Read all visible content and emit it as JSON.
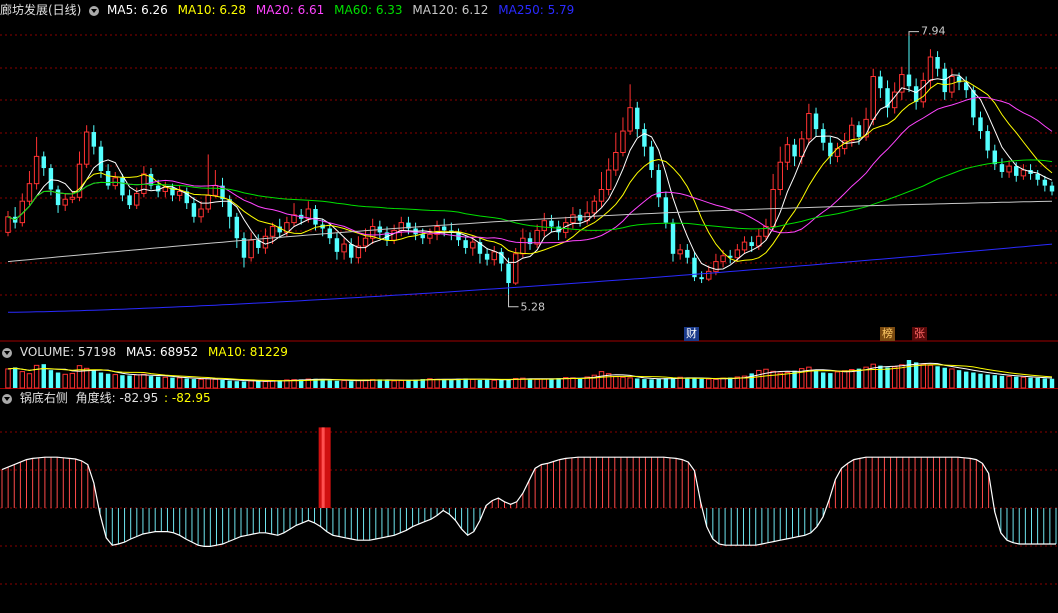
{
  "header_main": {
    "stock": "廊坊发展(日线)",
    "ma5": "MA5: 6.26",
    "ma10": "MA10: 6.28",
    "ma20": "MA20: 6.61",
    "ma60": "MA60: 6.33",
    "ma120": "MA120: 6.12",
    "ma250": "MA250: 5.79"
  },
  "header_volume": {
    "volume": "VOLUME: 57198",
    "ma5": "MA5: 68952",
    "ma10": "MA10: 81229"
  },
  "header_indicator": {
    "name": "锅底右侧",
    "angle_label": "角度线: -82.95",
    "angle_value": ": -82.95"
  },
  "annotations": {
    "high": "7.94",
    "low": "5.28",
    "marker_cai": "财",
    "marker_bang": "榜",
    "marker_zhang": "张"
  },
  "colors": {
    "ma5": "#ffffff",
    "ma10": "#ffff00",
    "ma20": "#ff44ff",
    "ma60": "#00e000",
    "ma120": "#c8c8c8",
    "ma250": "#2a2aff",
    "up": "#ff3232",
    "down": "#54ffff",
    "grid": "#8a0000"
  },
  "chart_data": [
    {
      "type": "candlestick",
      "title": "廊坊发展(日线)",
      "ylim": [
        5.0,
        8.1
      ],
      "annotations": [
        {
          "label": "7.94",
          "value": 7.94
        },
        {
          "label": "5.28",
          "value": 5.28
        }
      ],
      "candles": [
        [
          5.92,
          6.08,
          6.14,
          5.88
        ],
        [
          6.08,
          6.02,
          6.18,
          5.96
        ],
        [
          6.02,
          6.24,
          6.32,
          5.98
        ],
        [
          6.24,
          6.42,
          6.55,
          6.2
        ],
        [
          6.42,
          6.7,
          6.9,
          6.36
        ],
        [
          6.7,
          6.58,
          6.75,
          6.5
        ],
        [
          6.58,
          6.36,
          6.62,
          6.3
        ],
        [
          6.36,
          6.2,
          6.4,
          6.12
        ],
        [
          6.2,
          6.26,
          6.32,
          6.14
        ],
        [
          6.26,
          6.28,
          6.34,
          6.22
        ],
        [
          6.28,
          6.62,
          6.75,
          6.24
        ],
        [
          6.62,
          6.95,
          7.02,
          6.58
        ],
        [
          6.95,
          6.8,
          7.02,
          6.72
        ],
        [
          6.8,
          6.55,
          6.86,
          6.48
        ],
        [
          6.55,
          6.4,
          6.62,
          6.36
        ],
        [
          6.4,
          6.48,
          6.54,
          6.36
        ],
        [
          6.48,
          6.3,
          6.52,
          6.24
        ],
        [
          6.3,
          6.2,
          6.36,
          6.16
        ],
        [
          6.2,
          6.32,
          6.38,
          6.16
        ],
        [
          6.32,
          6.52,
          6.6,
          6.28
        ],
        [
          6.52,
          6.4,
          6.58,
          6.36
        ],
        [
          6.4,
          6.34,
          6.46,
          6.28
        ],
        [
          6.34,
          6.38,
          6.44,
          6.28
        ],
        [
          6.38,
          6.3,
          6.42,
          6.24
        ],
        [
          6.3,
          6.34,
          6.4,
          6.24
        ],
        [
          6.34,
          6.22,
          6.38,
          6.16
        ],
        [
          6.22,
          6.08,
          6.28,
          6.02
        ],
        [
          6.08,
          6.16,
          6.24,
          6.02
        ],
        [
          6.16,
          6.3,
          6.72,
          6.12
        ],
        [
          6.3,
          6.4,
          6.56,
          6.28
        ],
        [
          6.4,
          6.26,
          6.48,
          6.18
        ],
        [
          6.26,
          6.08,
          6.3,
          5.96
        ],
        [
          6.08,
          5.86,
          6.12,
          5.76
        ],
        [
          5.86,
          5.66,
          5.92,
          5.56
        ],
        [
          5.66,
          5.84,
          5.92,
          5.62
        ],
        [
          5.84,
          5.76,
          5.9,
          5.7
        ],
        [
          5.76,
          5.88,
          5.96,
          5.7
        ],
        [
          5.88,
          5.98,
          6.02,
          5.8
        ],
        [
          5.98,
          5.92,
          6.06,
          5.86
        ],
        [
          5.92,
          6.02,
          6.08,
          5.88
        ],
        [
          6.02,
          6.1,
          6.22,
          5.98
        ],
        [
          6.1,
          6.06,
          6.16,
          6.0
        ],
        [
          6.06,
          6.16,
          6.24,
          6.02
        ],
        [
          6.16,
          6.0,
          6.2,
          5.94
        ],
        [
          6.0,
          5.96,
          6.06,
          5.88
        ],
        [
          5.96,
          5.86,
          6.0,
          5.8
        ],
        [
          5.86,
          5.72,
          5.92,
          5.64
        ],
        [
          5.72,
          5.8,
          5.86,
          5.64
        ],
        [
          5.8,
          5.66,
          5.86,
          5.6
        ],
        [
          5.66,
          5.78,
          5.88,
          5.6
        ],
        [
          5.78,
          5.86,
          5.96,
          5.72
        ],
        [
          5.86,
          5.98,
          6.06,
          5.8
        ],
        [
          5.98,
          5.92,
          6.04,
          5.86
        ],
        [
          5.92,
          5.84,
          5.98,
          5.78
        ],
        [
          5.84,
          5.94,
          6.0,
          5.8
        ],
        [
          5.94,
          6.02,
          6.08,
          5.88
        ],
        [
          6.02,
          5.96,
          6.08,
          5.9
        ],
        [
          5.96,
          5.9,
          6.02,
          5.84
        ],
        [
          5.9,
          5.86,
          5.96,
          5.8
        ],
        [
          5.86,
          5.9,
          5.96,
          5.8
        ],
        [
          5.9,
          5.98,
          6.04,
          5.84
        ],
        [
          5.98,
          5.94,
          6.06,
          5.88
        ],
        [
          5.94,
          5.92,
          6.02,
          5.84
        ],
        [
          5.92,
          5.84,
          5.96,
          5.78
        ],
        [
          5.84,
          5.76,
          5.88,
          5.7
        ],
        [
          5.76,
          5.82,
          5.88,
          5.68
        ],
        [
          5.82,
          5.7,
          5.86,
          5.6
        ],
        [
          5.7,
          5.64,
          5.76,
          5.58
        ],
        [
          5.64,
          5.72,
          5.78,
          5.58
        ],
        [
          5.72,
          5.6,
          5.76,
          5.52
        ],
        [
          5.6,
          5.4,
          5.66,
          5.28
        ],
        [
          5.4,
          5.7,
          5.76,
          5.38
        ],
        [
          5.7,
          5.86,
          5.96,
          5.66
        ],
        [
          5.86,
          5.8,
          5.92,
          5.74
        ],
        [
          5.8,
          5.94,
          6.0,
          5.76
        ],
        [
          5.94,
          6.04,
          6.12,
          5.88
        ],
        [
          6.04,
          5.98,
          6.1,
          5.92
        ],
        [
          5.98,
          5.92,
          6.04,
          5.84
        ],
        [
          5.92,
          6.02,
          6.08,
          5.86
        ],
        [
          6.02,
          6.1,
          6.18,
          5.96
        ],
        [
          6.1,
          6.04,
          6.16,
          5.98
        ],
        [
          6.04,
          6.12,
          6.24,
          6.0
        ],
        [
          6.12,
          6.24,
          6.3,
          6.06
        ],
        [
          6.24,
          6.36,
          6.54,
          6.18
        ],
        [
          6.36,
          6.56,
          6.68,
          6.3
        ],
        [
          6.56,
          6.74,
          6.94,
          6.5
        ],
        [
          6.74,
          6.96,
          7.1,
          6.7
        ],
        [
          6.96,
          7.2,
          7.44,
          6.92
        ],
        [
          7.2,
          6.98,
          7.26,
          6.9
        ],
        [
          6.98,
          6.8,
          7.04,
          6.7
        ],
        [
          6.8,
          6.56,
          6.86,
          6.48
        ],
        [
          6.56,
          6.28,
          6.62,
          6.18
        ],
        [
          6.28,
          6.02,
          6.34,
          5.96
        ],
        [
          6.02,
          5.7,
          6.06,
          5.62
        ],
        [
          5.7,
          5.74,
          5.8,
          5.64
        ],
        [
          5.74,
          5.66,
          5.8,
          5.6
        ],
        [
          5.66,
          5.46,
          5.72,
          5.42
        ],
        [
          5.46,
          5.44,
          5.52,
          5.4
        ],
        [
          5.44,
          5.52,
          5.58,
          5.42
        ],
        [
          5.52,
          5.62,
          5.7,
          5.48
        ],
        [
          5.62,
          5.68,
          5.74,
          5.56
        ],
        [
          5.68,
          5.66,
          5.74,
          5.6
        ],
        [
          5.66,
          5.74,
          5.8,
          5.62
        ],
        [
          5.74,
          5.82,
          5.88,
          5.7
        ],
        [
          5.82,
          5.78,
          5.88,
          5.72
        ],
        [
          5.78,
          5.88,
          5.96,
          5.74
        ],
        [
          5.88,
          5.98,
          6.06,
          5.84
        ],
        [
          5.98,
          6.36,
          6.52,
          5.94
        ],
        [
          6.36,
          6.64,
          6.8,
          6.3
        ],
        [
          6.64,
          6.82,
          6.9,
          6.56
        ],
        [
          6.82,
          6.7,
          6.88,
          6.6
        ],
        [
          6.7,
          6.88,
          6.96,
          6.62
        ],
        [
          6.88,
          7.14,
          7.24,
          6.82
        ],
        [
          7.14,
          6.98,
          7.2,
          6.9
        ],
        [
          6.98,
          6.84,
          7.04,
          6.76
        ],
        [
          6.84,
          6.7,
          6.9,
          6.62
        ],
        [
          6.7,
          6.78,
          6.84,
          6.64
        ],
        [
          6.78,
          6.86,
          6.94,
          6.72
        ],
        [
          6.86,
          7.02,
          7.1,
          6.8
        ],
        [
          7.02,
          6.9,
          7.06,
          6.82
        ],
        [
          6.9,
          7.08,
          7.2,
          6.86
        ],
        [
          7.08,
          7.52,
          7.6,
          7.02
        ],
        [
          7.52,
          7.4,
          7.58,
          7.3
        ],
        [
          7.4,
          7.2,
          7.48,
          7.1
        ],
        [
          7.2,
          7.36,
          7.46,
          7.14
        ],
        [
          7.36,
          7.54,
          7.62,
          7.28
        ],
        [
          7.54,
          7.42,
          7.94,
          7.36
        ],
        [
          7.42,
          7.26,
          7.5,
          7.18
        ],
        [
          7.26,
          7.48,
          7.56,
          7.2
        ],
        [
          7.48,
          7.72,
          7.8,
          7.4
        ],
        [
          7.72,
          7.6,
          7.78,
          7.52
        ],
        [
          7.6,
          7.36,
          7.66,
          7.28
        ],
        [
          7.36,
          7.52,
          7.6,
          7.3
        ],
        [
          7.52,
          7.46,
          7.56,
          7.38
        ],
        [
          7.46,
          7.38,
          7.52,
          7.3
        ],
        [
          7.38,
          7.1,
          7.42,
          7.02
        ],
        [
          7.1,
          6.96,
          7.16,
          6.88
        ],
        [
          6.96,
          6.76,
          7.02,
          6.68
        ],
        [
          6.76,
          6.62,
          6.82,
          6.56
        ],
        [
          6.62,
          6.54,
          6.68,
          6.48
        ],
        [
          6.54,
          6.6,
          6.66,
          6.48
        ],
        [
          6.6,
          6.5,
          6.64,
          6.44
        ],
        [
          6.5,
          6.56,
          6.62,
          6.46
        ],
        [
          6.56,
          6.52,
          6.62,
          6.46
        ],
        [
          6.52,
          6.46,
          6.56,
          6.4
        ],
        [
          6.46,
          6.4,
          6.5,
          6.34
        ],
        [
          6.4,
          6.34,
          6.44,
          6.3
        ]
      ]
    },
    {
      "type": "bar",
      "title": "VOLUME",
      "series": [
        {
          "name": "VOLUME",
          "values": [
            128,
            138,
            110,
            96,
            152,
            160,
            120,
            104,
            92,
            98,
            150,
            132,
            118,
            104,
            96,
            90,
            86,
            84,
            88,
            92,
            80,
            76,
            72,
            70,
            68,
            64,
            60,
            58,
            62,
            58,
            54,
            50,
            46,
            44,
            48,
            46,
            44,
            50,
            52,
            54,
            56,
            58,
            60,
            62,
            56,
            52,
            48,
            50,
            46,
            52,
            54,
            56,
            58,
            52,
            48,
            50,
            54,
            56,
            60,
            62,
            58,
            56,
            60,
            62,
            64,
            58,
            54,
            56,
            52,
            56,
            60,
            64,
            66,
            62,
            58,
            60,
            64,
            66,
            70,
            68,
            62,
            74,
            86,
            110,
            96,
            76,
            72,
            68,
            64,
            60,
            58,
            62,
            66,
            70,
            72,
            68,
            64,
            62,
            60,
            58,
            66,
            70,
            74,
            80,
            98,
            118,
            126,
            112,
            100,
            104,
            116,
            130,
            140,
            120,
            104,
            100,
            108,
            116,
            124,
            130,
            140,
            160,
            150,
            138,
            142,
            156,
            188,
            172,
            160,
            152,
            146,
            136,
            128,
            120,
            110,
            104,
            96,
            90,
            86,
            82,
            78,
            76,
            72,
            70,
            68,
            64,
            62
          ]
        }
      ]
    },
    {
      "type": "bar",
      "title": "锅底右侧",
      "series": [
        {
          "name": "角度线",
          "values": [
            62,
            66,
            70,
            74,
            78,
            80,
            81,
            82,
            82,
            82,
            81,
            80,
            79,
            76,
            70,
            40,
            -10,
            -48,
            -60,
            -58,
            -55,
            -50,
            -46,
            -42,
            -40,
            -38,
            -38,
            -38,
            -40,
            -44,
            -50,
            -55,
            -60,
            -62,
            -62,
            -60,
            -58,
            -54,
            -50,
            -46,
            -44,
            -42,
            -40,
            -40,
            -42,
            -44,
            -40,
            -34,
            -28,
            -24,
            -20,
            -24,
            -30,
            -38,
            -44,
            -46,
            -48,
            -50,
            -52,
            -52,
            -52,
            -50,
            -48,
            -46,
            -44,
            -40,
            -36,
            -30,
            -26,
            -22,
            -18,
            -12,
            -4,
            -10,
            -20,
            -34,
            -44,
            -38,
            -20,
            4,
            12,
            16,
            10,
            6,
            10,
            24,
            44,
            64,
            70,
            72,
            75,
            78,
            80,
            81,
            82,
            82,
            82,
            82,
            82,
            82,
            82,
            82,
            82,
            82,
            82,
            82,
            82,
            82,
            82,
            81,
            80,
            78,
            74,
            60,
            10,
            -30,
            -50,
            -58,
            -60,
            -60,
            -60,
            -60,
            -60,
            -60,
            -58,
            -56,
            -54,
            -52,
            -50,
            -48,
            -46,
            -44,
            -40,
            -30,
            -14,
            14,
            46,
            64,
            72,
            78,
            80,
            82,
            82,
            82,
            82,
            82,
            82,
            82,
            82,
            82,
            82,
            82,
            82,
            82,
            82,
            82,
            82,
            81,
            80,
            78,
            72,
            56,
            -6,
            -40,
            -52,
            -56,
            -58,
            -58,
            -58,
            -58,
            -58,
            -58,
            -58
          ]
        }
      ],
      "highlight_bar": {
        "index": 52,
        "value": 130
      }
    }
  ]
}
